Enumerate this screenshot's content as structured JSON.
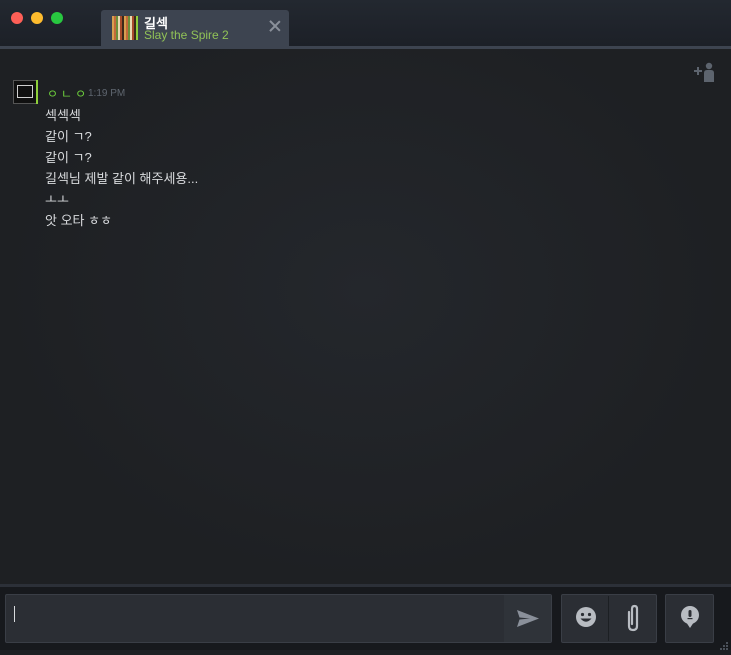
{
  "window": {
    "controls": [
      "close",
      "minimize",
      "maximize"
    ]
  },
  "tab": {
    "friend_name": "길섹",
    "game": "Slay the Spire 2",
    "close_icon": "close-icon"
  },
  "chat": {
    "invite_icon": "add-friend-icon",
    "message_group": {
      "sender": "ㅇㄴㅇ",
      "time": "1:19 PM",
      "lines": [
        "섹섹섹",
        "같이 ㄱ?",
        "같이 ㄱ?",
        "길섹님 제발 같이 해주세용...",
        "ㅗㅗ",
        "앗 오타 ㅎㅎ"
      ]
    }
  },
  "composer": {
    "input_value": "",
    "send_icon": "send-icon",
    "emoji_icon": "emoji-icon",
    "attach_icon": "paperclip-icon",
    "voice_icon": "voice-chat-icon"
  },
  "colors": {
    "accent_green": "#8ecf3a",
    "sender_green": "#6dcf3c",
    "game_green": "#91c257",
    "background": "#1e2024"
  }
}
